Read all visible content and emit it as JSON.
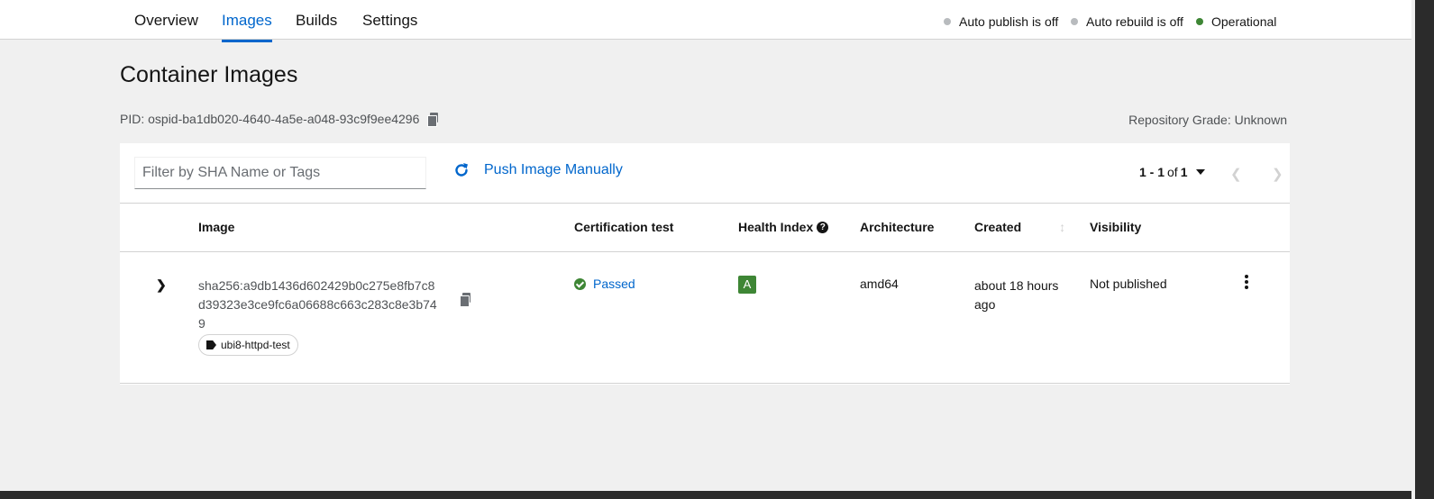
{
  "nav": {
    "tabs": [
      {
        "label": "Overview"
      },
      {
        "label": "Images"
      },
      {
        "label": "Builds"
      },
      {
        "label": "Settings"
      }
    ],
    "status": [
      {
        "label": "Auto publish is off",
        "color": "#b8bbbe"
      },
      {
        "label": "Auto rebuild is off",
        "color": "#b8bbbe"
      },
      {
        "label": "Operational",
        "color": "#3e8635"
      }
    ]
  },
  "page": {
    "title": "Container Images",
    "pid": "PID: ospid-ba1db020-4640-4a5e-a048-93c9f9ee4296",
    "repository_grade": "Repository Grade: Unknown"
  },
  "toolbar": {
    "filter_placeholder": "Filter by SHA Name or Tags",
    "push_label": "Push Image Manually",
    "pagination": {
      "range": "1 - 1",
      "of": "of",
      "total": "1"
    }
  },
  "table": {
    "columns": [
      "Image",
      "Certification test",
      "Health Index",
      "Architecture",
      "Created",
      "Visibility"
    ],
    "rows": [
      {
        "sha": "sha256:a9db1436d602429b0c275e8fb7c8d39323e3ce9fc6a06688c663c283c8e3b749",
        "tag": "ubi8-httpd-test",
        "certification": "Passed",
        "health_index": "A",
        "architecture": "amd64",
        "created": "about 18 hours ago",
        "visibility": "Not published"
      }
    ]
  }
}
